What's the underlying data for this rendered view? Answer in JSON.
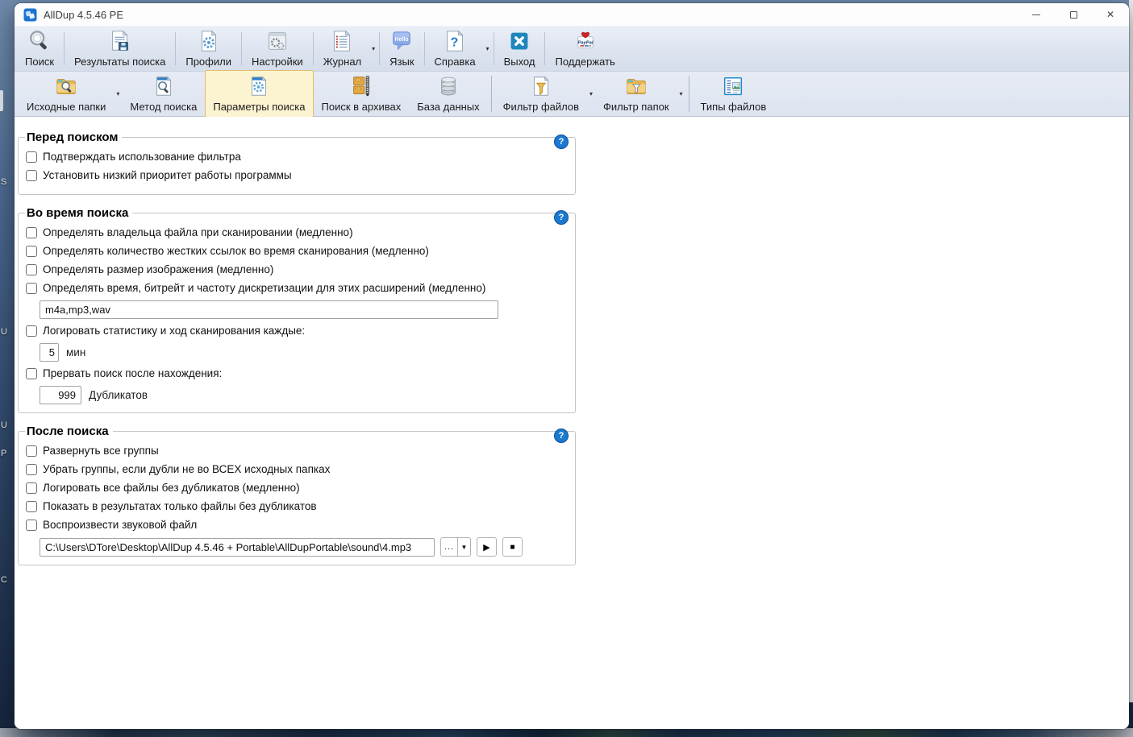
{
  "window": {
    "title": "AllDup 4.5.46 PE"
  },
  "icons": {
    "close_glyph": "✕",
    "toolbar_dropdown_glyph": "▾",
    "split_dropdown_glyph": "▼",
    "play_glyph": "▶",
    "stop_glyph": "■",
    "help_glyph": "?"
  },
  "palette": {
    "toolbar_bg": "#dde4f0",
    "active_button_bg": "#fcf3d1",
    "active_button_border": "#dfc06c",
    "help_badge_blue": "#1b79cf",
    "exit_button_blue": "#1f86bd",
    "folder_gold": "#e9b84f"
  },
  "toolbar_main": {
    "items": [
      {
        "label": "Поиск",
        "icon": "search"
      },
      {
        "label": "Результаты поиска",
        "icon": "search-results"
      },
      {
        "label": "Профили",
        "icon": "profiles"
      },
      {
        "label": "Настройки",
        "icon": "settings"
      },
      {
        "label": "Журнал",
        "icon": "journal",
        "has_dropdown": true
      },
      {
        "label": "Язык",
        "icon": "language-bubble",
        "bubble_text": "Hello"
      },
      {
        "label": "Справка",
        "icon": "help-document",
        "has_dropdown": true
      },
      {
        "label": "Выход",
        "icon": "exit"
      },
      {
        "label": "Поддержать",
        "icon": "paypal-heart",
        "icon_text": "PayPal"
      }
    ]
  },
  "toolbar_secondary": {
    "items": [
      {
        "label": "Исходные папки",
        "icon": "source-folders",
        "has_dropdown": true
      },
      {
        "label": "Метод поиска",
        "icon": "search-method"
      },
      {
        "label": "Параметры поиска",
        "icon": "search-options",
        "active": true
      },
      {
        "label": "Поиск в архивах",
        "icon": "archive-search"
      },
      {
        "label": "База данных",
        "icon": "database"
      },
      {
        "label": "Фильтр файлов",
        "icon": "file-filter",
        "has_dropdown": true
      },
      {
        "label": "Фильтр папок",
        "icon": "folder-filter",
        "has_dropdown": true
      },
      {
        "label": "Типы файлов",
        "icon": "file-types"
      }
    ]
  },
  "groups": {
    "before": {
      "title": "Перед поиском",
      "checkboxes": [
        "Подтверждать использование фильтра",
        "Установить низкий приоритет работы программы"
      ]
    },
    "during": {
      "title": "Во время поиска",
      "checkboxes": [
        "Определять владельца файла при сканировании (медленно)",
        "Определять количество жестких ссылок во время сканирования (медленно)",
        "Определять размер изображения (медленно)",
        "Определять время, битрейт и частоту дискретизации для этих расширений (медленно)",
        "Логировать статистику и ход сканирования каждые:",
        "Прервать поиск после нахождения:"
      ],
      "extensions_value": "m4a,mp3,wav",
      "log_interval_value": "5",
      "log_interval_unit": "мин",
      "stop_after_value": "999",
      "stop_after_unit": "Дубликатов"
    },
    "after": {
      "title": "После поиска",
      "checkboxes": [
        "Развернуть все группы",
        "Убрать группы, если дубли не во ВСЕХ исходных папках",
        "Логировать все файлы без дубликатов (медленно)",
        "Показать в результатах только файлы без дубликатов",
        "Воспроизвести звуковой файл"
      ],
      "sound_file_path": "C:\\Users\\DTore\\Desktop\\AllDup 4.5.46 + Portable\\AllDupPortable\\sound\\4.mp3",
      "browse_label": "..."
    }
  },
  "desktop": {
    "icon_letters": [
      "S",
      "U",
      "U",
      "P",
      "C"
    ]
  }
}
